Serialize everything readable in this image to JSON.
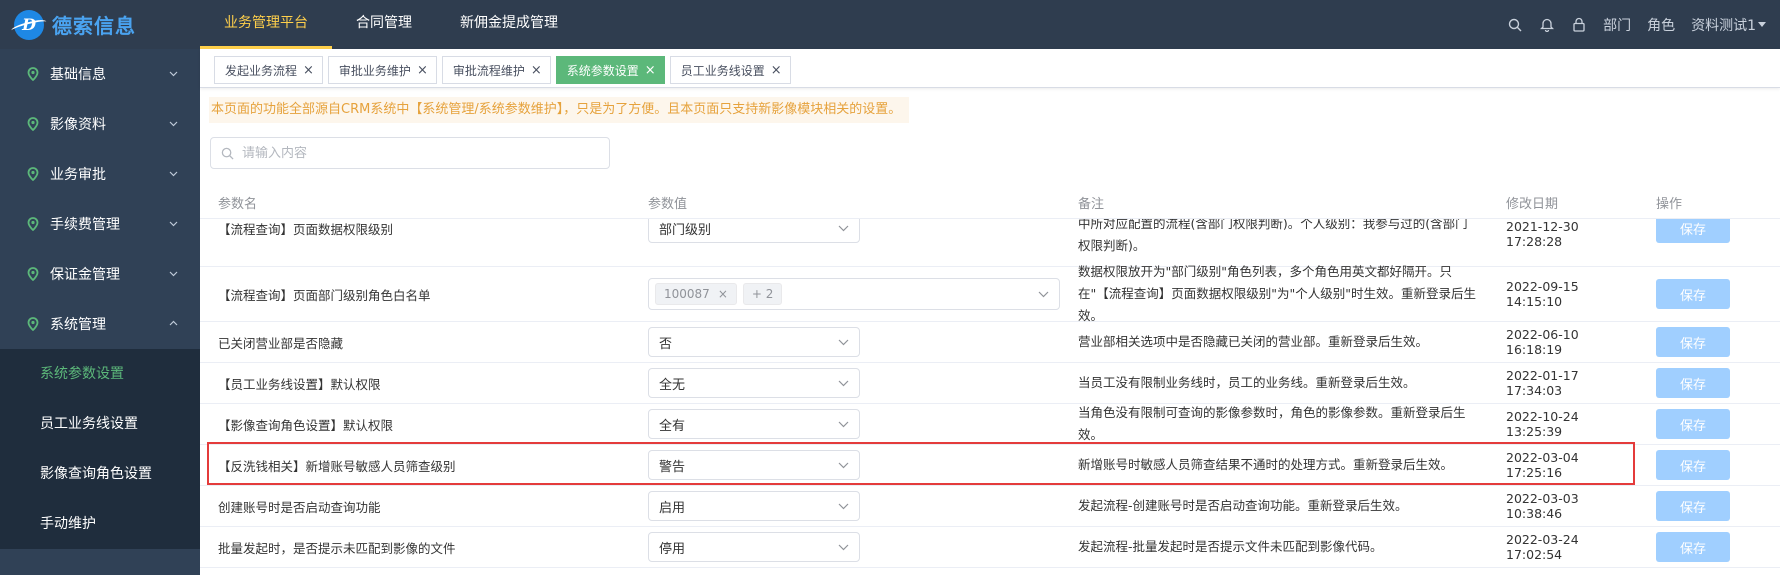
{
  "brand": {
    "name": "德索信息"
  },
  "topnav": [
    {
      "label": "业务管理平台",
      "active": true
    },
    {
      "label": "合同管理",
      "active": false
    },
    {
      "label": "新佣金提成管理",
      "active": false
    }
  ],
  "topright": {
    "dept": "部门",
    "role": "角色",
    "user": "资料测试1"
  },
  "sidebar": {
    "items": [
      {
        "label": "基础信息"
      },
      {
        "label": "影像资料"
      },
      {
        "label": "业务审批"
      },
      {
        "label": "手续费管理"
      },
      {
        "label": "保证金管理"
      },
      {
        "label": "系统管理"
      }
    ],
    "sub_items": [
      {
        "label": "系统参数设置",
        "active": true
      },
      {
        "label": "员工业务线设置",
        "active": false
      },
      {
        "label": "影像查询角色设置",
        "active": false
      },
      {
        "label": "手动维护",
        "active": false
      }
    ]
  },
  "tabs": [
    {
      "label": "发起业务流程",
      "active": false
    },
    {
      "label": "审批业务维护",
      "active": false
    },
    {
      "label": "审批流程维护",
      "active": false
    },
    {
      "label": "系统参数设置",
      "active": true
    },
    {
      "label": "员工业务线设置",
      "active": false
    }
  ],
  "notice": "本页面的功能全部源自CRM系统中【系统管理/系统参数维护】，只是为了方便。且本页面只支持新影像模块相关的设置。",
  "search": {
    "placeholder": "请输入内容"
  },
  "table": {
    "headers": {
      "name": "参数名",
      "value": "参数值",
      "note": "备注",
      "date": "修改日期",
      "action": "操作"
    },
    "save_label": "保存",
    "rows": [
      {
        "name": "【流程查询】页面数据权限级别",
        "value": "部门级别",
        "note": "中所对应配置的流程(含部门权限判断)。个人级别：我参与过的(含部门权限判断)。",
        "date": "2021-12-30 17:28:28"
      },
      {
        "name": "【流程查询】页面部门级别角色白名单",
        "tag1": "100087",
        "tag2": "+ 2",
        "note": "数据权限放开为\"部门级别\"角色列表，多个角色用英文都好隔开。只在\"【流程查询】页面数据权限级别\"为\"个人级别\"时生效。重新登录后生效。",
        "date": "2022-09-15 14:15:10"
      },
      {
        "name": "已关闭营业部是否隐藏",
        "value": "否",
        "note": "营业部相关选项中是否隐藏已关闭的营业部。重新登录后生效。",
        "date": "2022-06-10 16:18:19"
      },
      {
        "name": "【员工业务线设置】默认权限",
        "value": "全无",
        "note": "当员工没有限制业务线时，员工的业务线。重新登录后生效。",
        "date": "2022-01-17 17:34:03"
      },
      {
        "name": "【影像查询角色设置】默认权限",
        "value": "全有",
        "note": "当角色没有限制可查询的影像参数时，角色的影像参数。重新登录后生效。",
        "date": "2022-10-24 13:25:39"
      },
      {
        "name": "【反洗钱相关】新增账号敏感人员筛查级别",
        "value": "警告",
        "note": "新增账号时敏感人员筛查结果不通时的处理方式。重新登录后生效。",
        "date": "2022-03-04 17:25:16"
      },
      {
        "name": "创建账号时是否启动查询功能",
        "value": "启用",
        "note": "发起流程-创建账号时是否启动查询功能。重新登录后生效。",
        "date": "2022-03-03 10:38:46"
      },
      {
        "name": "批量发起时，是否提示未匹配到影像的文件",
        "value": "停用",
        "note": "发起流程-批量发起时是否提示文件未匹配到影像代码。",
        "date": "2022-03-24 17:02:54"
      }
    ]
  },
  "colors": {
    "topbar": "#2f3d4f",
    "sidebar": "#304156",
    "active_green": "#5cb87a",
    "accent_yellow": "#ffd04b",
    "highlight_red": "#e43b3b",
    "save_button": "#a0cfff"
  }
}
